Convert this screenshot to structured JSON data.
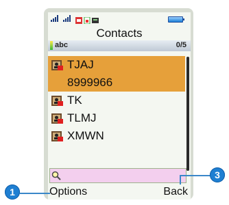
{
  "window": {
    "title": "Contacts"
  },
  "status": {
    "input_mode": "abc",
    "count": "0/5"
  },
  "contacts": [
    {
      "name": "TJAJ",
      "number": "8999966",
      "selected": true
    },
    {
      "name": "TK"
    },
    {
      "name": "TLMJ"
    },
    {
      "name": "XMWN"
    }
  ],
  "softkeys": {
    "left": "Options",
    "right": "Back"
  },
  "callouts": {
    "left": "1",
    "right": "3"
  },
  "icons": {
    "signal": "signal-bars-icon",
    "sim_card": "sim-card-icon",
    "battery": "battery-icon",
    "contact": "contact-card-icon",
    "search": "search-icon"
  },
  "colors": {
    "selected_row": "#e6a03a",
    "search_field": "#f3cfee",
    "callout": "#1f7fd2"
  }
}
